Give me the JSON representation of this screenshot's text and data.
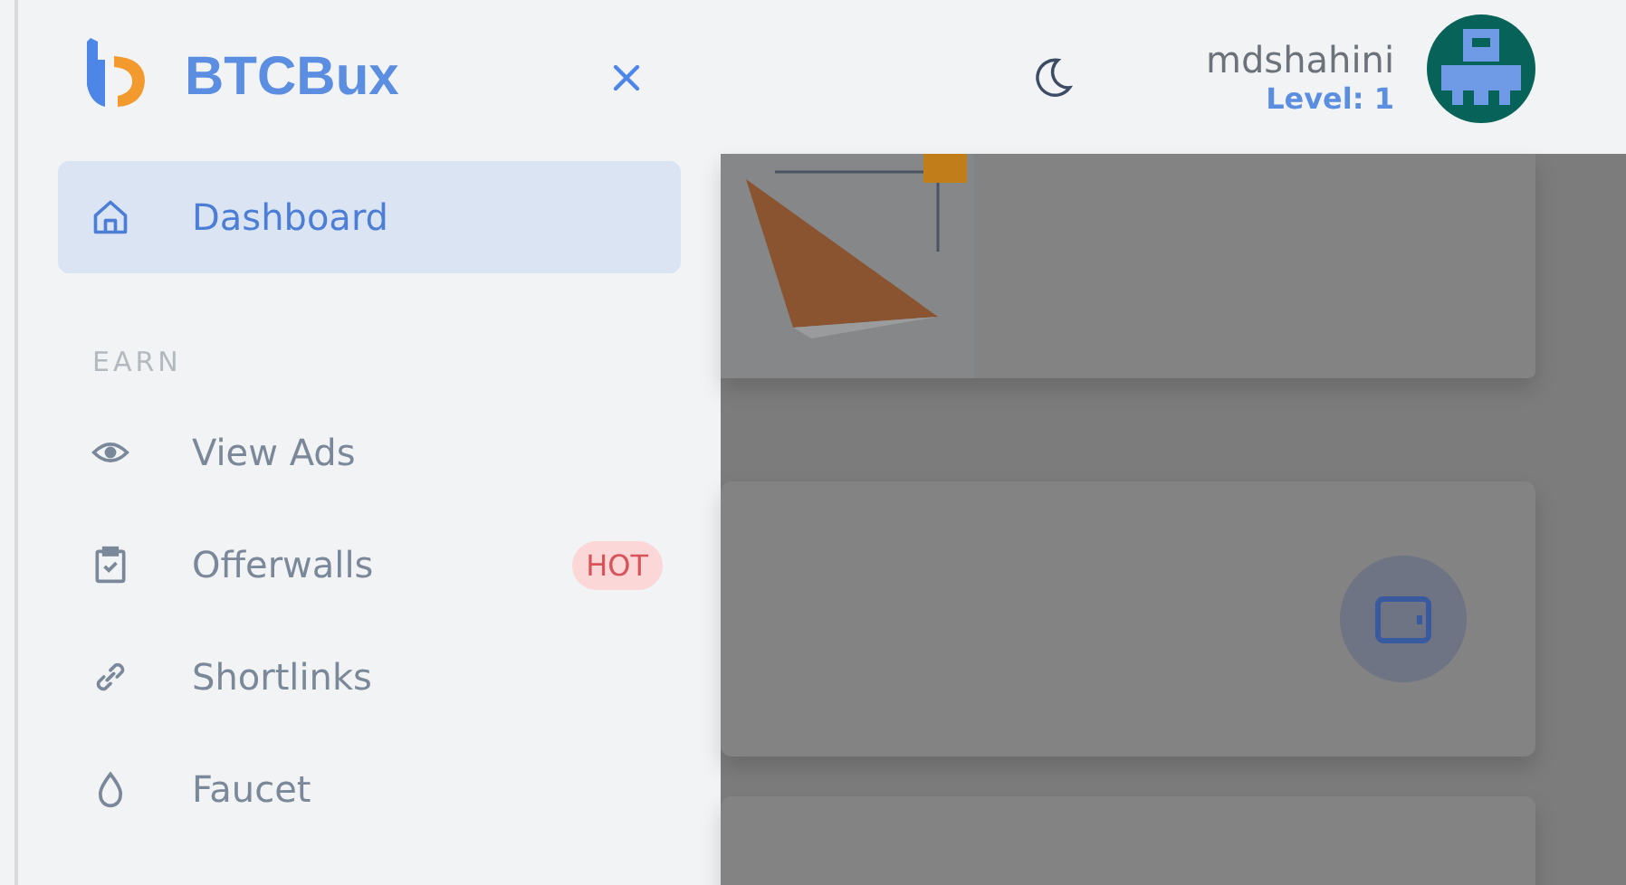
{
  "brand": {
    "name": "BTCBux"
  },
  "header": {
    "username": "mdshahini",
    "level": "Level: 1"
  },
  "sidebar": {
    "items": [
      {
        "label": "Dashboard",
        "kind": "home",
        "selected": true
      }
    ],
    "sections": [
      {
        "title": "EARN",
        "items": [
          {
            "label": "View Ads",
            "kind": "eye",
            "selected": false
          },
          {
            "label": "Offerwalls",
            "kind": "clipboard",
            "selected": false,
            "badge": "HOT"
          },
          {
            "label": "Shortlinks",
            "kind": "link",
            "selected": false
          },
          {
            "label": "Faucet",
            "kind": "drop",
            "selected": false
          }
        ]
      }
    ]
  }
}
